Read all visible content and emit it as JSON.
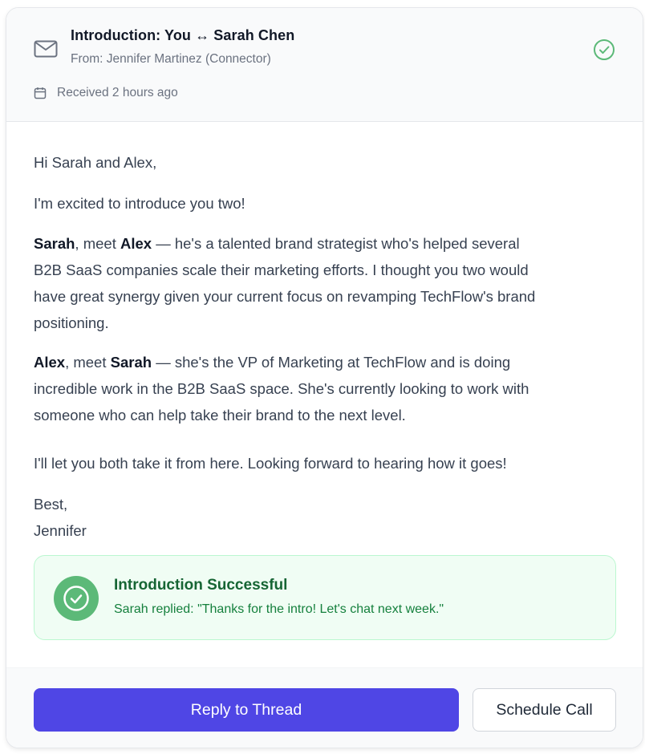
{
  "header": {
    "title": "Introduction: You ↔ Sarah Chen",
    "from": "From: Jennifer Martinez (Connector)",
    "received": "Received 2 hours ago",
    "mail_icon": "mail-icon",
    "status_icon": "check-circle-icon",
    "calendar_icon": "calendar-icon"
  },
  "email": {
    "greeting": "Hi Sarah and Alex,",
    "intro": "I'm excited to introduce you two!",
    "p1": {
      "name1": "Sarah",
      "sep": ", meet ",
      "name2": "Alex",
      "line1": " — he's a talented brand strategist who's helped several",
      "line2": "B2B SaaS companies scale their marketing efforts. I thought you two would",
      "line3": "have great synergy given your current focus on revamping TechFlow's brand",
      "line4": "positioning."
    },
    "p2": {
      "name1": "Alex",
      "sep": ", meet ",
      "name2": "Sarah",
      "line1": " — she's the VP of Marketing at TechFlow and is doing",
      "line2": "incredible work in the B2B SaaS space. She's currently looking to work with",
      "line3": "someone who can help take their brand to the next level."
    },
    "closing": "I'll let you both take it from here. Looking forward to hearing how it goes!",
    "signoff": "Best,",
    "signature": "Jennifer"
  },
  "success": {
    "title": "Introduction Successful",
    "message": "Sarah replied: \"Thanks for the intro! Let's chat next week.\"",
    "icon": "check-circle-icon"
  },
  "actions": {
    "reply_label": "Reply to Thread",
    "schedule_label": "Schedule Call"
  },
  "colors": {
    "accent": "#4f46e5",
    "success": "#5cb978",
    "success_bg": "#f0fdf4"
  }
}
